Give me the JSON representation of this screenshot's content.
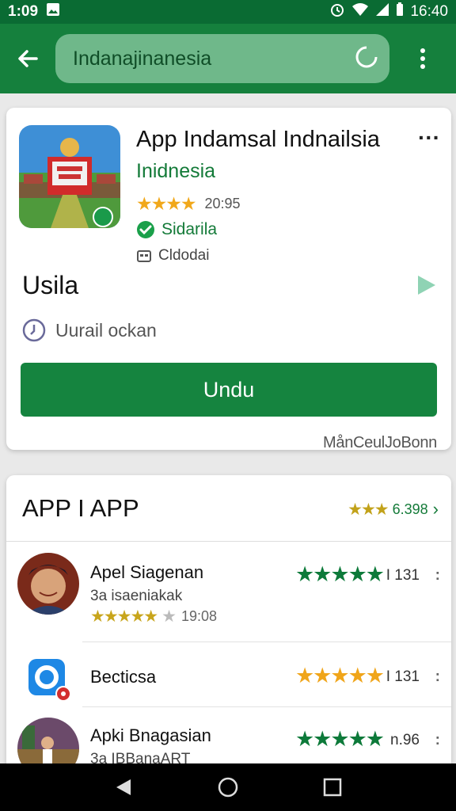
{
  "status_bar": {
    "time_left": "1:09",
    "time_right": "16:40"
  },
  "search": {
    "value": "Indanajinanesia"
  },
  "app": {
    "title": "App Indamsal Indnailsia",
    "developer": "Inidnesia",
    "rating_value": "20:95",
    "verified_label": "Sidarila",
    "category_label": "Cldodai",
    "section_title": "Usila",
    "update_label": "Uurail ockan",
    "install_label": "Undu",
    "footer_link": "MånCeulJoBonn"
  },
  "list": {
    "title": "APP I APP",
    "header_rating_value": "6.398",
    "items": [
      {
        "name": "Apel Siagenan",
        "sub": "3a isaeniakak",
        "sub_rating": "19:08",
        "count": "I 131",
        "stars_color": "green"
      },
      {
        "name": "Becticsa",
        "sub": "",
        "sub_rating": "",
        "count": "I 131",
        "stars_color": "gold"
      },
      {
        "name": "Apki Bnagasian",
        "sub": "3a IBBanaART",
        "sub_rating": "",
        "count": "n.96",
        "stars_color": "green"
      }
    ]
  },
  "colors": {
    "primary": "#15803d",
    "status_bar": "#0a6b33",
    "star_gold": "#f1a81b",
    "star_green": "#0d7a3a"
  },
  "icons": [
    "back-arrow-icon",
    "search-clear-icon",
    "overflow-menu-icon",
    "verified-check-icon",
    "category-icon",
    "play-icon",
    "clock-icon",
    "nav-back-icon",
    "nav-home-icon",
    "nav-recents-icon"
  ]
}
